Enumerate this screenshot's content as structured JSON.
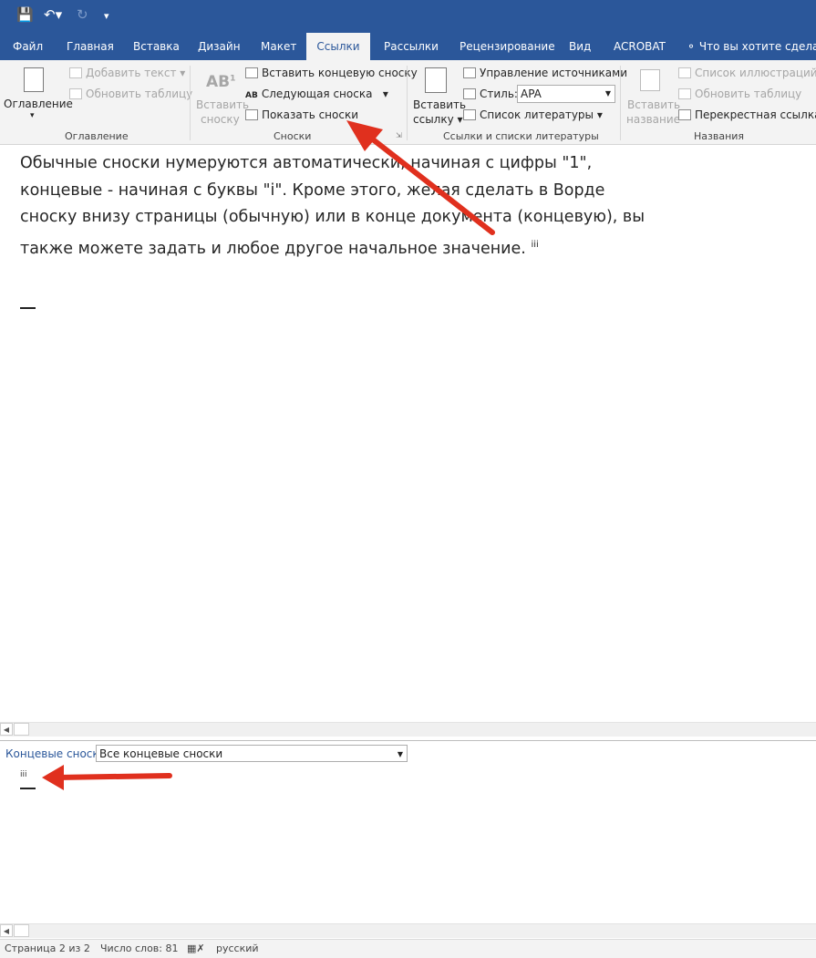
{
  "tabs": [
    "Файл",
    "Главная",
    "Вставка",
    "Дизайн",
    "Макет",
    "Ссылки",
    "Рассылки",
    "Рецензирование",
    "Вид",
    "ACROBAT"
  ],
  "tell_me": "Что вы хотите сделать?",
  "ribbon": {
    "toc": {
      "label": "Оглавление",
      "add_text": "Добавить текст",
      "update_table": "Обновить таблицу",
      "group": "Оглавление"
    },
    "footnotes": {
      "insert_line1": "Вставить",
      "insert_line2": "сноску",
      "insert_endnote": "Вставить концевую сноску",
      "next_footnote": "Следующая сноска",
      "show_notes": "Показать сноски",
      "group": "Сноски"
    },
    "citations": {
      "insert_line1": "Вставить",
      "insert_line2": "ссылку",
      "manage_sources": "Управление источниками",
      "style_label": "Стиль:",
      "style_value": "APA",
      "bibliography": "Список литературы",
      "group": "Ссылки и списки литературы"
    },
    "captions": {
      "insert_line1": "Вставить",
      "insert_line2": "название",
      "table_of_figures": "Список иллюстраций",
      "update_table": "Обновить таблицу",
      "cross_reference": "Перекрестная ссылка",
      "group": "Названия"
    }
  },
  "document": {
    "text": "Обычные сноски нумеруются автоматически, начиная с цифры \"1\", концевые - начиная с буквы \"i\". Кроме этого, желая сделать в Ворде сноску внизу страницы (обычную) или в конце документа (концевую), вы также можете задать и любое другое начальное значение.",
    "note_ref": "iii"
  },
  "notes_pane": {
    "label": "Концевые сноски",
    "select_value": "Все концевые сноски",
    "note_mark": "iii"
  },
  "status": {
    "page": "Страница 2 из 2",
    "words": "Число слов: 81",
    "language": "русский"
  },
  "colors": {
    "accent": "#2b579a",
    "arrow": "#e0301e"
  }
}
